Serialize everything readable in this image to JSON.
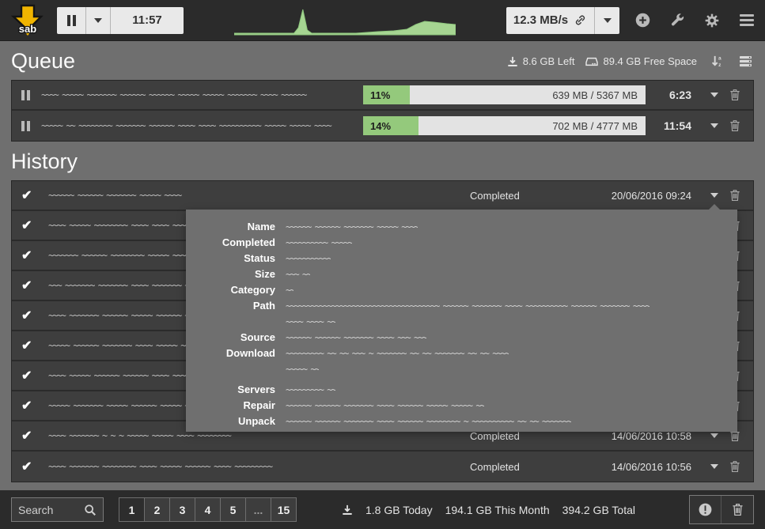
{
  "topbar": {
    "logo_text": "sab",
    "timer": "11:57",
    "speed": "12.3 MB/s",
    "graph_points": [
      [
        0,
        3
      ],
      [
        10,
        3
      ],
      [
        20,
        3
      ],
      [
        27,
        3
      ],
      [
        29,
        10
      ],
      [
        31,
        33
      ],
      [
        33,
        7
      ],
      [
        35,
        3
      ],
      [
        45,
        3
      ],
      [
        55,
        3
      ],
      [
        60,
        4
      ],
      [
        65,
        5
      ],
      [
        72,
        6
      ],
      [
        78,
        8
      ],
      [
        82,
        14
      ],
      [
        86,
        18
      ],
      [
        90,
        17
      ],
      [
        96,
        15
      ],
      [
        100,
        14
      ]
    ]
  },
  "queue": {
    "title": "Queue",
    "remaining": "8.6 GB Left",
    "free_space": "89.4 GB Free Space",
    "items": [
      {
        "name_scribble": "~~~~ ~~~~~ ~~~~~~~ ~~~~~~ ~~~~~~ ~~~~~ ~~~~~ ~~~~~~~ ~~~~ ~~~~~~",
        "pct": 11,
        "pct_label": "11%",
        "size": "639 MB / 5367 MB",
        "eta": "6:23"
      },
      {
        "name_scribble": "~~~~~ ~~ ~~~~~~~~ ~~~~~~~ ~~~~~~ ~~~~ ~~~~ ~~~~~~~~~~ ~~~~~ ~~~~~ ~~~~",
        "pct": 14,
        "pct_label": "14%",
        "size": "702 MB / 4777 MB",
        "eta": "11:54"
      }
    ]
  },
  "history": {
    "title": "History",
    "rows": [
      {
        "scribble": "~~~~~~ ~~~~~~ ~~~~~~~ ~~~~~ ~~~~",
        "status": "Completed",
        "date": "20/06/2016 09:24"
      },
      {
        "scribble": "~~~~ ~~~~~ ~~~~~~~~ ~~~~ ~~~~ ~~~~~~~ ~~~~~ ~~~~~~ ~~~~~"
      },
      {
        "scribble": "~~~~~~~ ~~~~~~ ~~~~~~~~ ~~~~~ ~~~~~~ ~~~~ ~~~~~ ~~~~~"
      },
      {
        "scribble": "~~~ ~~~~~~~ ~~~~~~~ ~~~~ ~~~~~~~ ~~~~~ ~~~~~ ~~~~~~"
      },
      {
        "scribble": "~~~~ ~~~~~~~ ~~~~~~ ~~~~~ ~~~~~~ ~~~~~~ ~~~~ ~~~~~"
      },
      {
        "scribble": "~~~~~ ~~~~~~ ~~~~~~~ ~~~~ ~~~~~ ~~~~~~~ ~~~~~ ~~~~"
      },
      {
        "scribble": "~~~~ ~~~~~ ~~~~~~ ~~~~~~ ~~~~ ~~~~~~ ~~~~~ ~~~~~~"
      },
      {
        "scribble": "~~~~~ ~~~~~~~ ~~~~~ ~~~~~~ ~~~~~ ~~~~ ~~~~~~ ~~~~~"
      },
      {
        "scribble": "~~~~ ~~~~~~~ ~ ~ ~ ~~~~~ ~~~~~ ~~~~ ~~~~~~~~",
        "status": "Completed",
        "date": "14/06/2016 10:58"
      },
      {
        "scribble": "~~~~ ~~~~~~~ ~~~~~~~~ ~~~~ ~~~~~ ~~~~~~ ~~~~ ~~~~~~~~~",
        "status": "Completed",
        "date": "14/06/2016 10:56"
      }
    ],
    "details": [
      {
        "label": "Name",
        "value": "~~~~~~ ~~~~~~ ~~~~~~~ ~~~~~ ~~~~"
      },
      {
        "label": "Completed",
        "value": "~~~~~~~~~~ ~~~~~"
      },
      {
        "label": "Status",
        "value": "~~~~~~~~~~~"
      },
      {
        "label": "Size",
        "value": "~~~ ~~"
      },
      {
        "label": "Category",
        "value": "~~"
      },
      {
        "label": "Path",
        "value": "~~~~~~~~~~~~~~~~~~~~~~~~~~~~~~~~~~~~~ ~~~~~~ ~~~~~~~ ~~~~ ~~~~~~~~~~ ~~~~~~ ~~~~~~~ ~~~~",
        "value2": "~~~~ ~~~~ ~~"
      },
      {
        "label": "Source",
        "value": "~~~~~~ ~~~~~~ ~~~~~~~ ~~~~ ~~~ ~~~"
      },
      {
        "label": "Download",
        "value": "~~~~~~~~~ ~~ ~~ ~~~ ~ ~~~~~~~ ~~ ~~ ~~~~~~~ ~~ ~~ ~~~~",
        "value2": "~~~~~ ~~"
      },
      {
        "label": "Servers",
        "value": "~~~~~~~~~ ~~"
      },
      {
        "label": "Repair",
        "value": "~~~~~~ ~~~~~~ ~~~~~~~ ~~~~ ~~~~~~ ~~~~~ ~~~~~ ~~"
      },
      {
        "label": "Unpack",
        "value": "~~~~~~ ~~~~~~ ~~~~~~~ ~~~~ ~~~~~~ ~~~~~~~~ ~ ~~~~~~~~~~ ~~ ~~ ~~~~~~~"
      }
    ]
  },
  "footer": {
    "search_placeholder": "Search",
    "pages": [
      "1",
      "2",
      "3",
      "4",
      "5",
      "...",
      "15"
    ],
    "stats": {
      "today": "1.8 GB Today",
      "month": "194.1 GB This Month",
      "total": "394.2 GB Total"
    }
  }
}
